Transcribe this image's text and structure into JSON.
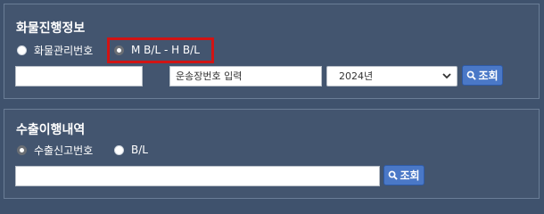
{
  "cargo_progress": {
    "title": "화물진행정보",
    "radio_options": [
      {
        "label": "화물관리번호",
        "checked": false
      },
      {
        "label": "M B/L - H B/L",
        "checked": true
      }
    ],
    "input1_value": "",
    "input2_placeholder": "운송장번호 입력",
    "year_select": "2024년",
    "search_button": "조회"
  },
  "export_history": {
    "title": "수출이행내역",
    "radio_options": [
      {
        "label": "수출신고번호",
        "checked": true
      },
      {
        "label": "B/L",
        "checked": false
      }
    ],
    "input_value": "",
    "search_button": "조회"
  },
  "colors": {
    "background": "#3f526d",
    "highlight": "#d11414",
    "button": "#4a78c7"
  },
  "icons": [
    "search-icon",
    "chevron-down-icon"
  ]
}
